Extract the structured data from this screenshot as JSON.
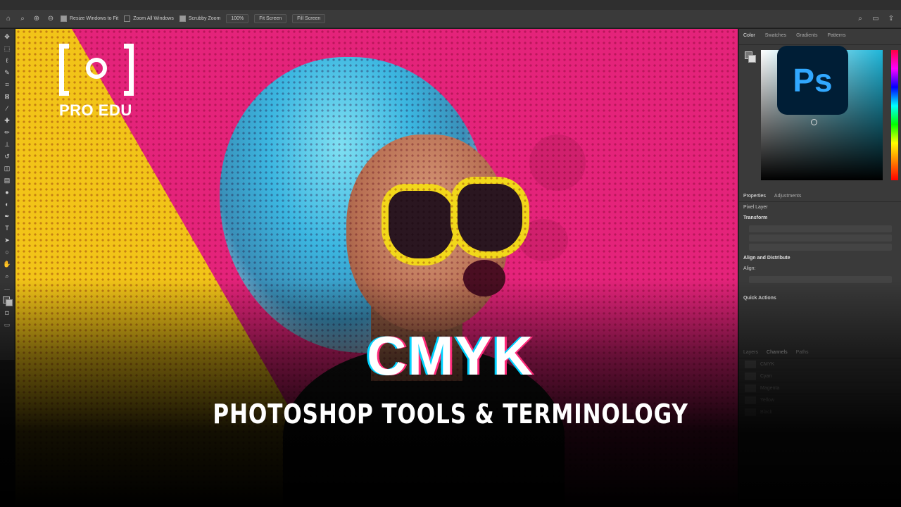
{
  "brand": {
    "logo_text": "PRO EDU",
    "app_badge": "Ps",
    "accent_cyan": "#00d2ff",
    "accent_magenta": "#ff2a7a",
    "yellow": "#f2c418"
  },
  "options_bar": {
    "resize_windows": "Resize Windows to Fit",
    "zoom_all": "Zoom All Windows",
    "scrubby_zoom": "Scrubby Zoom",
    "zoom_level": "100%",
    "fit_screen": "Fit Screen",
    "fill_screen": "Fill Screen"
  },
  "color_panel": {
    "tabs": [
      "Color",
      "Swatches",
      "Gradients",
      "Patterns"
    ]
  },
  "properties_panel": {
    "tabs": [
      "Properties",
      "Adjustments"
    ],
    "layer_type": "Pixel Layer",
    "transform": "Transform",
    "align": "Align and Distribute",
    "align_label": "Align:",
    "quick_actions": "Quick Actions"
  },
  "layers_panel": {
    "tabs": [
      "Layers",
      "Channels",
      "Paths"
    ],
    "channels": [
      "CMYK",
      "Cyan",
      "Magenta",
      "Yellow",
      "Black"
    ]
  },
  "headline": {
    "title": "CMYK",
    "subtitle": "PHOTOSHOP TOOLS & TERMINOLOGY"
  }
}
